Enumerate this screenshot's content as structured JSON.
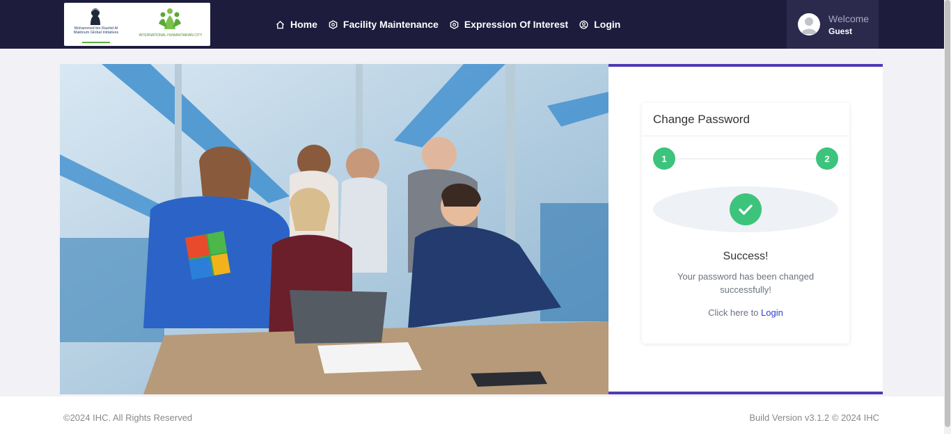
{
  "header": {
    "logo_left_text": "Mohammed bin Rashid Al Maktoum Global Initiatives",
    "logo_right_text": "INTERNATIONAL HUMANITARIAN CITY",
    "nav": [
      {
        "label": "Home",
        "icon": "home-icon"
      },
      {
        "label": "Facility Maintenance",
        "icon": "hexagon-icon"
      },
      {
        "label": "Expression Of Interest",
        "icon": "hexagon-icon"
      },
      {
        "label": "Login",
        "icon": "user-circle-icon"
      }
    ],
    "user": {
      "welcome": "Welcome",
      "name": "Guest"
    }
  },
  "card": {
    "title": "Change Password",
    "steps": [
      "1",
      "2"
    ],
    "success_title": "Success!",
    "success_message": "Your password has been changed successfully!",
    "login_prompt": "Click here to",
    "login_link": "Login"
  },
  "footer": {
    "copyright": "©2024 IHC. All Rights Reserved",
    "build": "Build Version v3.1.2 © 2024 IHC"
  },
  "colors": {
    "header_bg": "#1e1c3c",
    "accent": "#4f3bb5",
    "success": "#3cc47c",
    "link": "#2b3fc8"
  }
}
